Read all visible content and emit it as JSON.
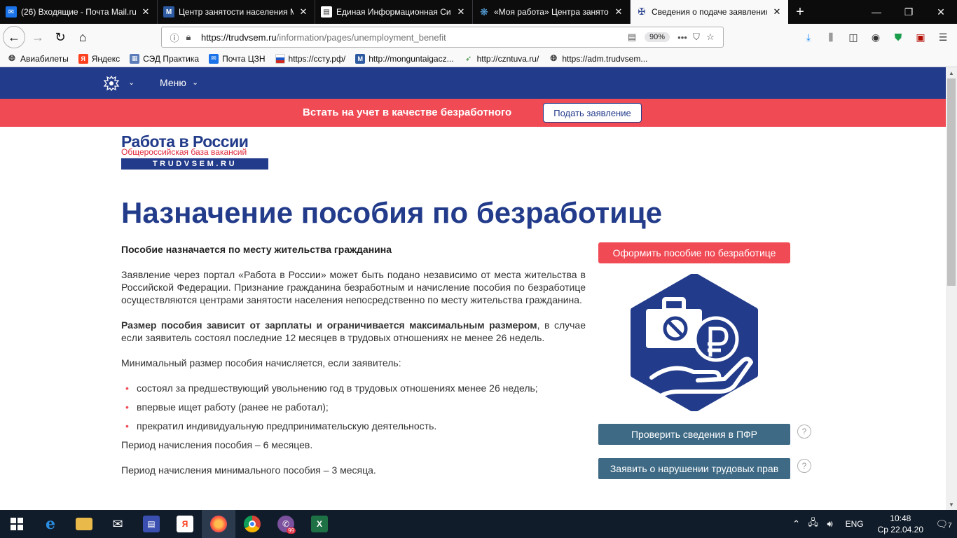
{
  "browser": {
    "tabs": [
      {
        "title": "(26) Входящие - Почта Mail.ru",
        "icon": "mail-icon",
        "active": false
      },
      {
        "title": "Центр занятости населения М",
        "icon": "site-m-icon",
        "active": false
      },
      {
        "title": "Единая Информационная Сис",
        "icon": "page-icon",
        "active": false
      },
      {
        "title": "«Моя работа» Центра занято",
        "icon": "snowflake-icon",
        "active": false
      },
      {
        "title": "Сведения о подаче заявления",
        "icon": "emblem-icon",
        "active": true
      }
    ],
    "url_host": "https://trudvsem.ru",
    "url_path": "/information/pages/unemployment_benefit",
    "zoom": "90%",
    "bookmarks": [
      {
        "label": "Авиабилеты",
        "icon": "globe-icon"
      },
      {
        "label": "Яндекс",
        "icon": "yandex-icon"
      },
      {
        "label": "СЭД Практика",
        "icon": "doc-icon"
      },
      {
        "label": "Почта ЦЗН",
        "icon": "mail-icon"
      },
      {
        "label": "https://ссту.рф/",
        "icon": "flag-icon"
      },
      {
        "label": "http://monguntaigacz...",
        "icon": "site-m-icon"
      },
      {
        "label": "http://czntuva.ru/",
        "icon": "leaf-icon"
      },
      {
        "label": "https://adm.trudvsem...",
        "icon": "globe-icon"
      }
    ]
  },
  "site": {
    "nav": {
      "menu_label": "Меню"
    },
    "banner": {
      "text": "Встать на учет в качестве безработного",
      "button": "Подать заявление"
    },
    "logo": {
      "main": "Работа в России",
      "sub": "Общероссийская база вакансий",
      "domain": "TRUDVSEM.RU"
    },
    "page_title": "Назначение пособия по безработице",
    "content": {
      "lead": "Пособие назначается по месту жительства гражданина",
      "p1": "Заявление через портал «Работа в России» может быть подано независимо от места жительства в Российской Федерации. Признание гражданина безработным и начисление пособия по безработице осуществляются центрами занятости населения непосредственно по месту жительства гражданина.",
      "p2_bold": "Размер пособия зависит от зарплаты и ограничивается максимальным размером",
      "p2_rest": ", в случае если заявитель состоял последние 12 месяцев в трудовых отношениях не менее 26 недель.",
      "p3": "Минимальный размер пособия начисляется, если заявитель:",
      "bullets": [
        "состоял за предшествующий увольнению год в трудовых отношениях менее 26 недель;",
        "впервые ищет работу (ранее не работал);",
        "прекратил индивидуальную предпринимательскую деятельность."
      ],
      "p4": "Период начисления пособия – 6 месяцев.",
      "p5": "Период начисления минимального пособия – 3 месяца."
    },
    "sidebar": {
      "apply_button": "Оформить пособие по безработице",
      "pfr_button": "Проверить сведения в ПФР",
      "violation_button": "Заявить о нарушении трудовых прав",
      "help": "?"
    },
    "colors": {
      "brand_blue": "#223b8a",
      "accent_red": "#f04a55",
      "button_steel": "#3e6a85"
    }
  },
  "taskbar": {
    "lang": "ENG",
    "time": "10:48",
    "date": "Ср 22.04.20",
    "notifications": "7",
    "viber_badge": "99"
  }
}
